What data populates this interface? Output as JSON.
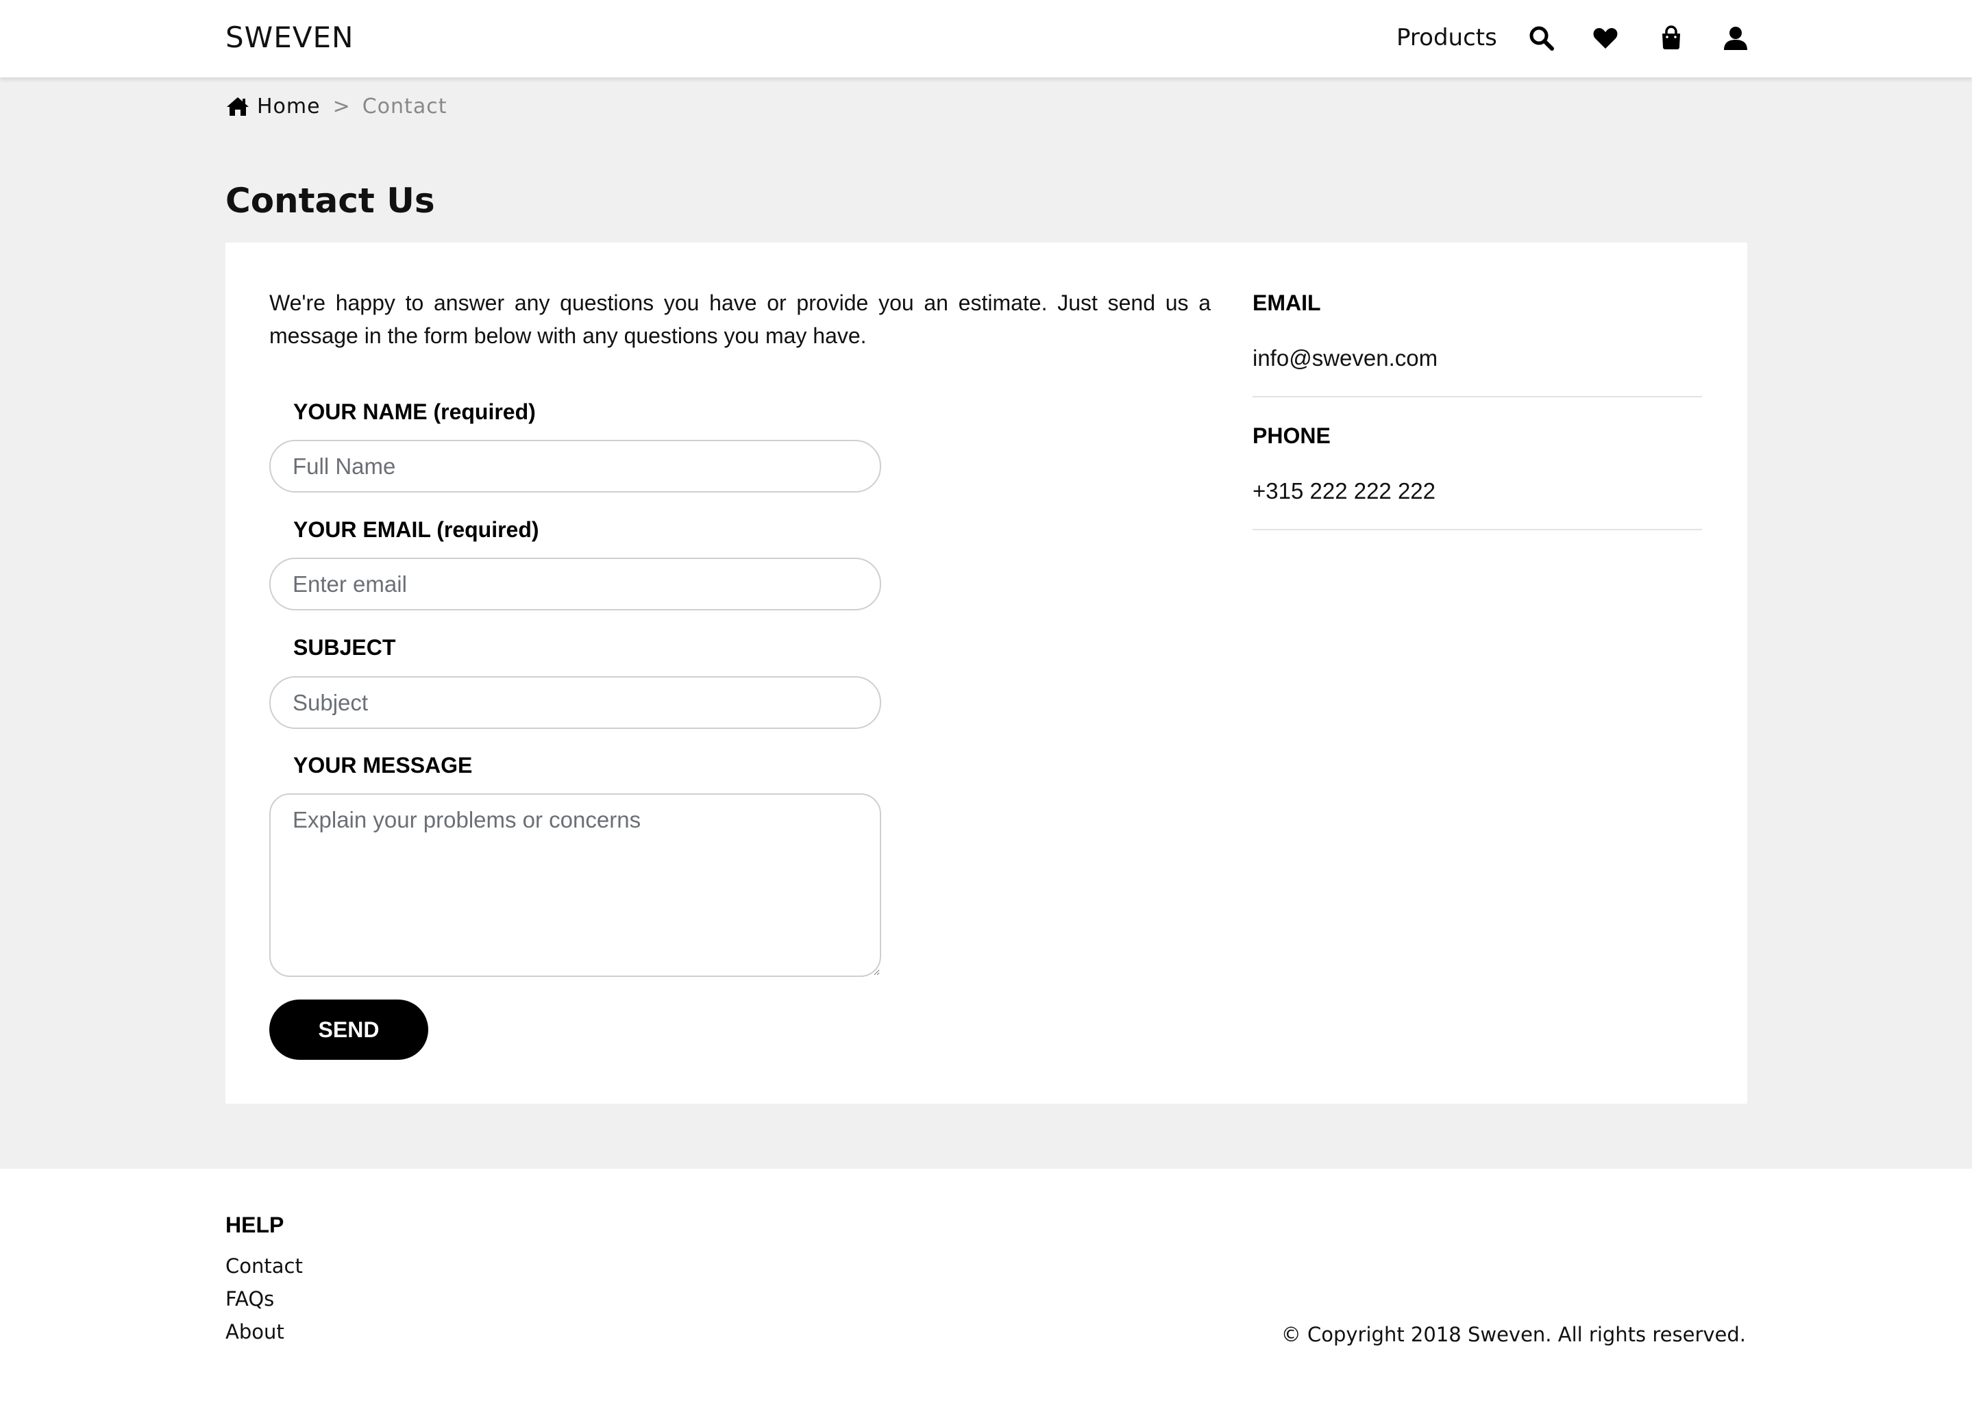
{
  "header": {
    "brand": "SWEVEN",
    "nav_products": "Products",
    "icons": [
      "search-icon",
      "heart-icon",
      "shopping-bag-icon",
      "user-icon"
    ]
  },
  "breadcrumb": {
    "home": "Home",
    "separator": ">",
    "current": "Contact"
  },
  "page": {
    "title": "Contact Us",
    "intro": "We're happy to answer any questions you have or provide you an estimate. Just send us a message in the form below with any questions you may have."
  },
  "form": {
    "name_label": "YOUR NAME (required)",
    "name_placeholder": "Full Name",
    "email_label": "YOUR EMAIL (required)",
    "email_placeholder": "Enter email",
    "subject_label": "SUBJECT",
    "subject_placeholder": "Subject",
    "message_label": "YOUR MESSAGE",
    "message_placeholder": "Explain your problems or concerns",
    "send_label": "SEND"
  },
  "contact_info": {
    "email_title": "EMAIL",
    "email_value": "info@sweven.com",
    "phone_title": "PHONE",
    "phone_value": "+315 222 222 222"
  },
  "footer": {
    "help_heading": "HELP",
    "links": [
      "Contact",
      "FAQs",
      "About"
    ],
    "copyright": "© Copyright 2018 Sweven. All rights reserved."
  },
  "colors": {
    "page_background": "#f0f0f0",
    "card_background": "#ffffff",
    "button_background": "#000000",
    "button_text": "#ffffff",
    "muted_text": "#888888"
  }
}
